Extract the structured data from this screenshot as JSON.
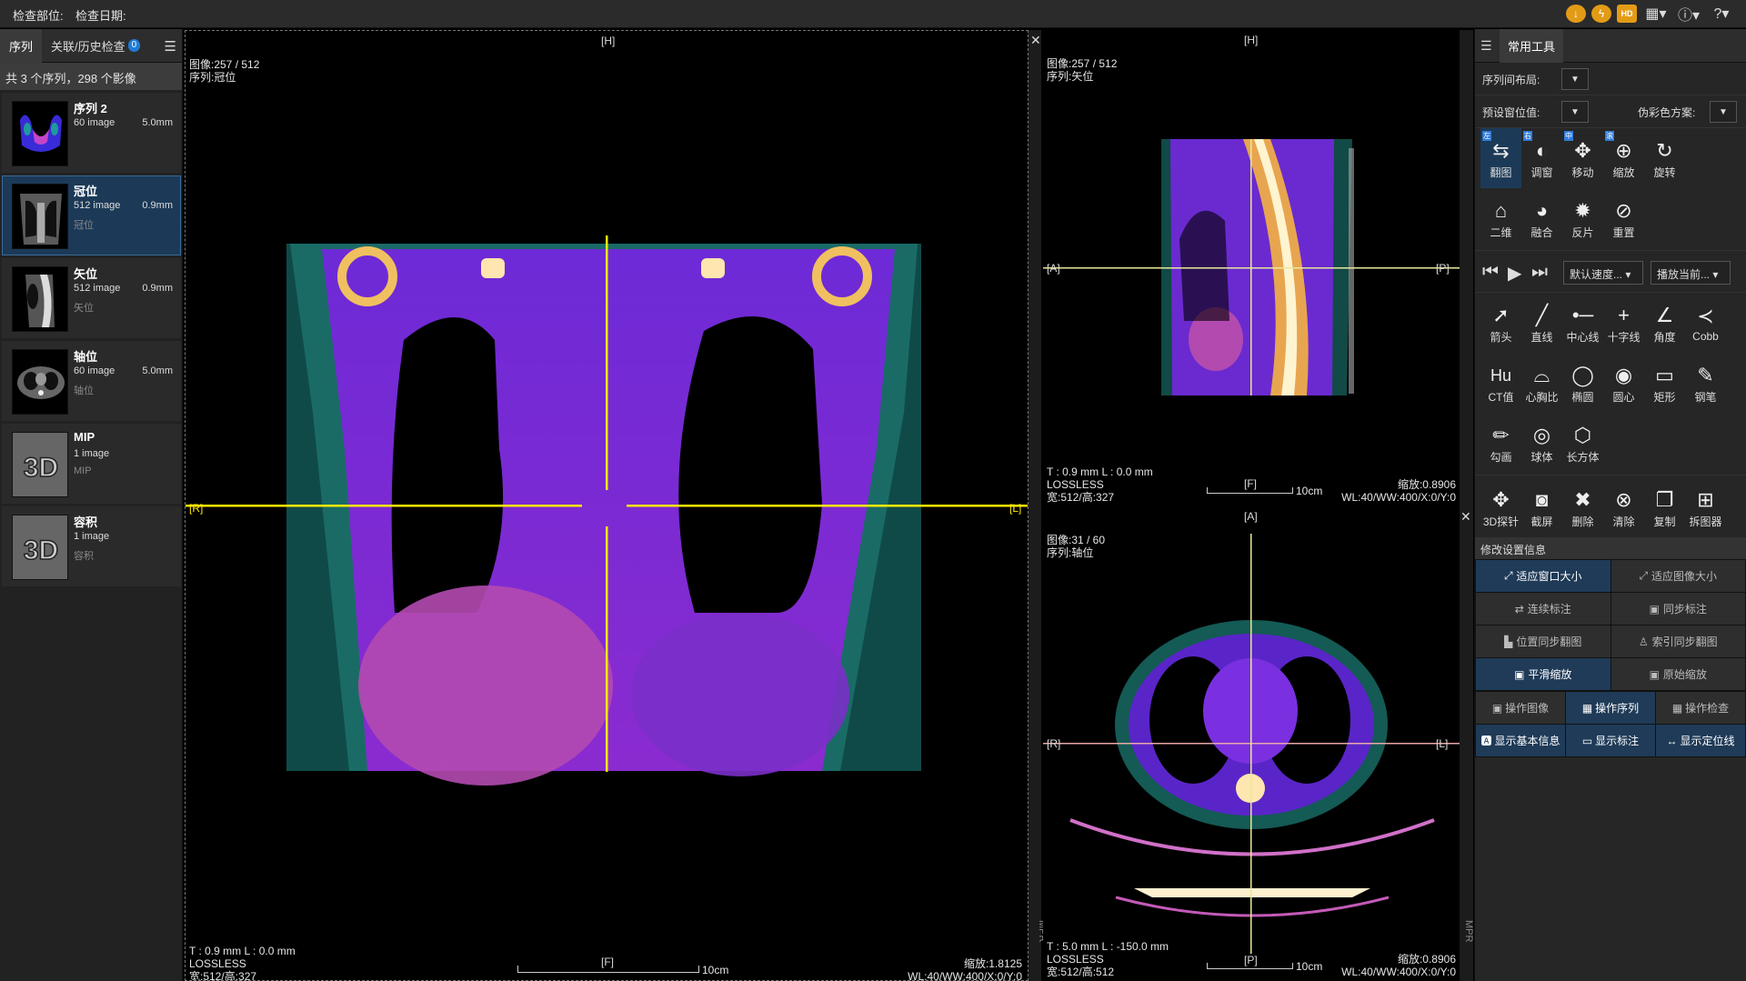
{
  "topbar": {
    "exam_part_label": "检查部位:",
    "exam_date_label": "检查日期:",
    "icons": [
      "download-icon",
      "lightning-icon",
      "hd-icon",
      "layout-icon",
      "info-icon",
      "help-icon"
    ],
    "hd_text": "HD"
  },
  "sidebar": {
    "tabs": [
      {
        "label": "序列"
      },
      {
        "label": "关联/历史检查",
        "badge": "0"
      }
    ],
    "summary": "共 3 个序列，298 个影像",
    "series": [
      {
        "name": "序列 2",
        "count": "60 image",
        "thickness": "5.0mm",
        "sub": ""
      },
      {
        "name": "冠位",
        "count": "512 image",
        "thickness": "0.9mm",
        "sub": "冠位"
      },
      {
        "name": "矢位",
        "count": "512 image",
        "thickness": "0.9mm",
        "sub": "矢位"
      },
      {
        "name": "轴位",
        "count": "60 image",
        "thickness": "5.0mm",
        "sub": "轴位"
      },
      {
        "name": "MIP",
        "count": "1 image",
        "thickness": "",
        "sub": "MIP"
      },
      {
        "name": "容积",
        "count": "1 image",
        "thickness": "",
        "sub": "容积"
      }
    ],
    "thumb_3d_text": "3D"
  },
  "views": {
    "coronal": {
      "image_idx": "图像:257 / 512",
      "series": "序列:冠位",
      "top": "[H]",
      "bottom": "[F]",
      "left": "[R]",
      "right": "[L]",
      "tl": "T : 0.9 mm L : 0.0 mm",
      "compress": "LOSSLESS",
      "size": "宽:512/高:327",
      "zoom": "缩放:1.8125",
      "wl": "WL:40/WW:400/X:0/Y:0",
      "scale": "10cm",
      "mpr": "MPR"
    },
    "sagittal": {
      "image_idx": "图像:257 / 512",
      "series": "序列:矢位",
      "top": "[H]",
      "bottom": "[F]",
      "left": "[A]",
      "right": "[P]",
      "tl": "T : 0.9 mm L : 0.0 mm",
      "compress": "LOSSLESS",
      "size": "宽:512/高:327",
      "zoom": "缩放:0.8906",
      "wl": "WL:40/WW:400/X:0/Y:0",
      "scale": "10cm"
    },
    "axial": {
      "image_idx": "图像:31 / 60",
      "series": "序列:轴位",
      "top": "[A]",
      "bottom": "[P]",
      "left": "[R]",
      "right": "[L]",
      "tl": "T : 5.0 mm L : -150.0 mm",
      "compress": "LOSSLESS",
      "size": "宽:512/高:512",
      "zoom": "缩放:0.8906",
      "wl": "WL:40/WW:400/X:0/Y:0",
      "scale": "10cm",
      "mpr": "MPR"
    }
  },
  "right_panel": {
    "tab": "常用工具",
    "layout_label": "序列间布局:",
    "window_label": "预设窗位值:",
    "pseudo_label": "伪彩色方案:",
    "tools_row1": [
      {
        "label": "翻图",
        "icon": "page-flip-icon",
        "mark": "左"
      },
      {
        "label": "调窗",
        "icon": "contrast-icon",
        "mark": "右"
      },
      {
        "label": "移动",
        "icon": "move-icon",
        "mark": "中"
      },
      {
        "label": "缩放",
        "icon": "zoom-icon",
        "mark": "滚"
      },
      {
        "label": "旋转",
        "icon": "rotate-icon",
        "mark": ""
      }
    ],
    "tools_row2": [
      {
        "label": "二维",
        "icon": "home-icon"
      },
      {
        "label": "融合",
        "icon": "fusion-icon"
      },
      {
        "label": "反片",
        "icon": "invert-icon"
      },
      {
        "label": "重置",
        "icon": "reset-icon"
      }
    ],
    "speed_select": "默认速度...",
    "play_select": "播放当前...",
    "tools_row3": [
      {
        "label": "箭头",
        "icon": "arrow-tool-icon"
      },
      {
        "label": "直线",
        "icon": "line-tool-icon"
      },
      {
        "label": "中心线",
        "icon": "centerline-icon"
      },
      {
        "label": "十字线",
        "icon": "crosshair-icon"
      },
      {
        "label": "角度",
        "icon": "angle-icon"
      },
      {
        "label": "Cobb",
        "icon": "cobb-icon"
      }
    ],
    "tools_row4": [
      {
        "label": "CT值",
        "icon": "hu-icon"
      },
      {
        "label": "心胸比",
        "icon": "cardiothoracic-icon"
      },
      {
        "label": "椭圆",
        "icon": "ellipse-icon"
      },
      {
        "label": "圆心",
        "icon": "circle-center-icon"
      },
      {
        "label": "矩形",
        "icon": "rectangle-icon"
      },
      {
        "label": "钢笔",
        "icon": "pen-icon"
      }
    ],
    "tools_row5": [
      {
        "label": "勾画",
        "icon": "draw-icon"
      },
      {
        "label": "球体",
        "icon": "sphere-icon"
      },
      {
        "label": "长方体",
        "icon": "cuboid-icon"
      }
    ],
    "tools_row6": [
      {
        "label": "3D探针",
        "icon": "probe-icon"
      },
      {
        "label": "截屏",
        "icon": "camera-icon"
      },
      {
        "label": "删除",
        "icon": "delete-icon"
      },
      {
        "label": "清除",
        "icon": "clear-icon"
      },
      {
        "label": "复制",
        "icon": "copy-icon"
      },
      {
        "label": "拆图器",
        "icon": "split-icon"
      }
    ],
    "settings_title": "修改设置信息",
    "btns": [
      {
        "label": "适应窗口大小",
        "on": true
      },
      {
        "label": "适应图像大小",
        "on": false
      },
      {
        "label": "连续标注",
        "on": false
      },
      {
        "label": "同步标注",
        "on": false
      },
      {
        "label": "位置同步翻图",
        "on": false
      },
      {
        "label": "索引同步翻图",
        "on": false
      },
      {
        "label": "平滑缩放",
        "on": true
      },
      {
        "label": "原始缩放",
        "on": false
      }
    ],
    "btns3a": [
      {
        "label": "操作图像",
        "on": false
      },
      {
        "label": "操作序列",
        "on": true
      },
      {
        "label": "操作检查",
        "on": false
      }
    ],
    "btns3b": [
      {
        "label": "显示基本信息",
        "on": true
      },
      {
        "label": "显示标注",
        "on": true
      },
      {
        "label": "显示定位线",
        "on": true
      }
    ]
  }
}
